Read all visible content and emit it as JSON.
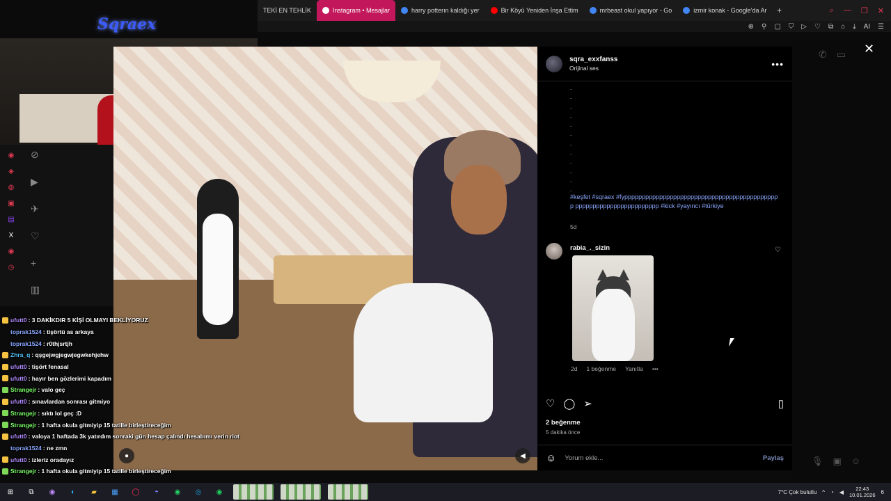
{
  "stream": {
    "brand": "Sqraex"
  },
  "browser": {
    "tabs": [
      {
        "label": "TEKİ EN TEHLİK",
        "color": "#777777",
        "active": false
      },
      {
        "label": "Instagram • Mesajlar",
        "color": "#ffffff",
        "active": true
      },
      {
        "label": "harry potterın kaldığı yer",
        "color": "#4285f4",
        "active": false
      },
      {
        "label": "Bir Köyü Yeniden İnşa Ettim",
        "color": "#ff0000",
        "active": false
      },
      {
        "label": "mrbeast okul yapıyor - Go",
        "color": "#4285f4",
        "active": false
      },
      {
        "label": "izmir konak - Google'da Ar",
        "color": "#4285f4",
        "active": false
      }
    ],
    "new_tab": "+",
    "toolbar_ai": "AI"
  },
  "post": {
    "username": "sqra_exxfanss",
    "audio": "Orijinal ses",
    "caption_dots": [
      ".",
      ".",
      ".",
      ".",
      ".",
      ".",
      ".",
      ".",
      ".",
      ".",
      ".",
      "."
    ],
    "hashtags": "#keşfet #sqraex #fyppppppppppppppppppppppppppppppppppppppppppppp pppppppppppppppppppppppp #kick #yayıncı #türkiye",
    "caption_time": "5d",
    "comment": {
      "username": "rabia_._sizin",
      "time": "2d",
      "likes": "1 beğenme",
      "reply": "Yanıtla",
      "more": "•••"
    },
    "likes": "2 beğenme",
    "time_ago": "5 dakika önce",
    "comment_placeholder": "Yorum ekle...",
    "share_label": "Paylaş"
  },
  "chat": [
    {
      "user": "ufutt0",
      "msg": ": 3 DAKİKDIR 5 KİŞİ OLMAYI BEKLİYORUZ",
      "color": "#b28cff",
      "badge": "#f5c242"
    },
    {
      "user": "toprak1524",
      "msg": ": tişörtü as arkaya",
      "color": "#8aa7ff",
      "badge": ""
    },
    {
      "user": "toprak1524",
      "msg": ": r0thjsrtjh",
      "color": "#8aa7ff",
      "badge": ""
    },
    {
      "user": "Zhra_q",
      "msg": ": qşgejwgjegwjegwkehjehw",
      "color": "#4fc3f7",
      "badge": "#f5c242"
    },
    {
      "user": "ufutt0",
      "msg": ": tişört fenasal",
      "color": "#b28cff",
      "badge": "#f5c242"
    },
    {
      "user": "ufutt0",
      "msg": ": hayır ben gözlerimi kapadım",
      "color": "#b28cff",
      "badge": "#f5c242"
    },
    {
      "user": "Strangejr",
      "msg": ": valo geç",
      "color": "#7dff6a",
      "badge": "#7dd957"
    },
    {
      "user": "ufutt0",
      "msg": ": sınavlardan sonrası gitmiyo",
      "color": "#b28cff",
      "badge": "#f5c242"
    },
    {
      "user": "Strangejr",
      "msg": ": sıktı lol geç :D",
      "color": "#7dff6a",
      "badge": "#7dd957"
    },
    {
      "user": "Strangejr",
      "msg": ": 1 hafta okula gitmiyip 15 tatille birleştireceğim",
      "color": "#7dff6a",
      "badge": "#7dd957"
    },
    {
      "user": "ufutt0",
      "msg": ": valoya 1 haftada 3k yatırdım sonraki gün hesap çalındı hesabımı verin riot",
      "color": "#b28cff",
      "badge": "#f5c242"
    },
    {
      "user": "toprak1524",
      "msg": ": ne zmn",
      "color": "#8aa7ff",
      "badge": ""
    },
    {
      "user": "ufutt0",
      "msg": ": izleriz oradayız",
      "color": "#b28cff",
      "badge": "#f5c242"
    },
    {
      "user": "Strangejr",
      "msg": ": 1 hafta okula gitmiyip 15 tatille birleştireceğim",
      "color": "#7dff6a",
      "badge": "#7dd957"
    }
  ],
  "taskbar": {
    "weather": "7°C  Çok bulutlu",
    "time": "22:43",
    "date": "10.01.2026",
    "notif": "6"
  }
}
